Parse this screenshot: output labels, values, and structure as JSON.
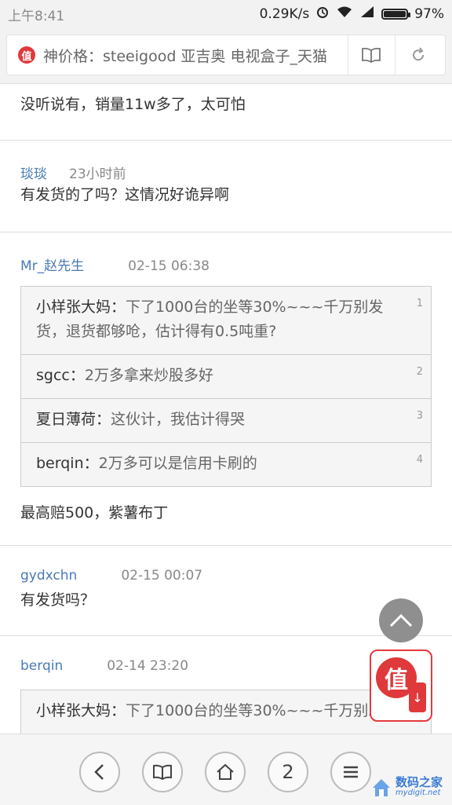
{
  "status_bar": {
    "time": "上午8:41",
    "speed": "0.29K/s",
    "battery": "97%"
  },
  "address_bar": {
    "favicon_char": "值",
    "url_title": "神价格：steeigood 亚吉奥 电视盒子_天猫"
  },
  "comments": [
    {
      "author": "",
      "time": "",
      "body": "没听说有，销量11w多了，太可怕"
    },
    {
      "author": "琰琰",
      "time": "23小时前",
      "body": "有发货的了吗？这情况好诡异啊"
    },
    {
      "author": "Mr_赵先生",
      "time": "02-15 06:38",
      "quotes": [
        {
          "name": "小样张大妈：",
          "text": "下了1000台的坐等30%~~~千万别发货，退货都够呛，估计得有0.5吨重?",
          "num": "1"
        },
        {
          "name": "sgcc：",
          "text": "2万多拿来炒股多好",
          "num": "2"
        },
        {
          "name": "夏日薄荷：",
          "text": "这伙计，我估计得哭",
          "num": "3"
        },
        {
          "name": "berqin：",
          "text": "2万多可以是信用卡刷的",
          "num": "4"
        }
      ],
      "body": "最高赔500，紫薯布丁"
    },
    {
      "author": "gydxchn",
      "time": "02-15 00:07",
      "body": "有发货吗？"
    },
    {
      "author": "berqin",
      "time": "02-14 23:20",
      "quotes": [
        {
          "name": "小样张大妈：",
          "text": "下了1000台的坐等30%~~~千万别发",
          "num": ""
        }
      ]
    }
  ],
  "floating": {
    "badge_char": "值"
  },
  "toolbar": {
    "tabs_count": "2"
  },
  "watermark": {
    "cn": "数码之家",
    "en": "mydigit.net"
  },
  "colors": {
    "accent_blue": "#4a7ab5",
    "brand_red": "#e0393b"
  }
}
